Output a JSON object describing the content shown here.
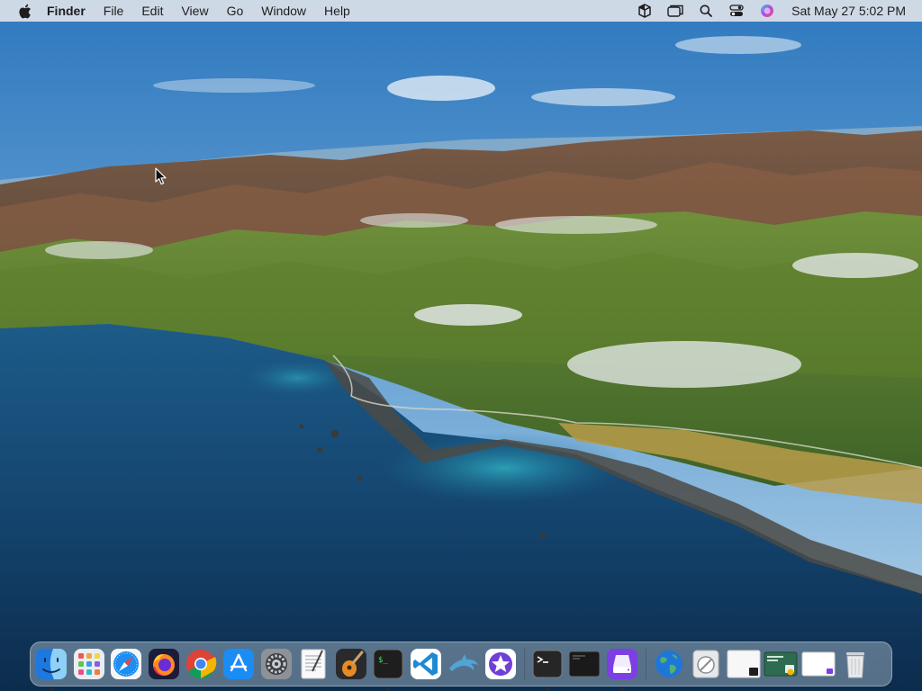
{
  "menubar": {
    "app_name": "Finder",
    "menus": [
      "File",
      "Edit",
      "View",
      "Go",
      "Window",
      "Help"
    ],
    "status_icons": [
      "box-icon",
      "window-icon",
      "spotlight-search-icon",
      "control-center-icon",
      "siri-icon"
    ],
    "clock": "Sat May 27  5:02 PM"
  },
  "dock": {
    "apps": [
      {
        "name": "Finder",
        "icon": "finder-icon",
        "running": true
      },
      {
        "name": "Launchpad",
        "icon": "launchpad-icon",
        "running": false
      },
      {
        "name": "Safari",
        "icon": "safari-icon",
        "running": false
      },
      {
        "name": "Firefox",
        "icon": "firefox-icon",
        "running": false
      },
      {
        "name": "Google Chrome",
        "icon": "chrome-icon",
        "running": true
      },
      {
        "name": "App Store",
        "icon": "app-store-icon",
        "running": false
      },
      {
        "name": "System Preferences",
        "icon": "system-preferences-icon",
        "running": false
      },
      {
        "name": "TextEdit",
        "icon": "textedit-icon",
        "running": false
      },
      {
        "name": "GarageBand",
        "icon": "garageband-icon",
        "running": false
      },
      {
        "name": "Terminal (iTerm)",
        "icon": "iterm-icon",
        "running": true
      },
      {
        "name": "Visual Studio Code",
        "icon": "vscode-icon",
        "running": false
      },
      {
        "name": "MySQL Workbench",
        "icon": "dolphin-icon",
        "running": false
      },
      {
        "name": "iMovie",
        "icon": "imovie-icon",
        "running": false
      }
    ],
    "recent": [
      {
        "name": "Terminal",
        "icon": "terminal-icon",
        "running": true
      },
      {
        "name": "Console",
        "icon": "console-icon",
        "running": false
      },
      {
        "name": "Storage App",
        "icon": "storage-icon",
        "running": true
      }
    ],
    "others": [
      {
        "name": "Network",
        "icon": "globe-icon"
      },
      {
        "name": "Utility",
        "icon": "utility-icon"
      },
      {
        "name": "Window Thumbnail 1",
        "icon": "window-thumbnail-icon"
      },
      {
        "name": "Window Thumbnail 2",
        "icon": "window-thumbnail-icon"
      },
      {
        "name": "Window Thumbnail 3",
        "icon": "window-thumbnail-icon"
      },
      {
        "name": "Trash",
        "icon": "trash-icon"
      }
    ]
  }
}
